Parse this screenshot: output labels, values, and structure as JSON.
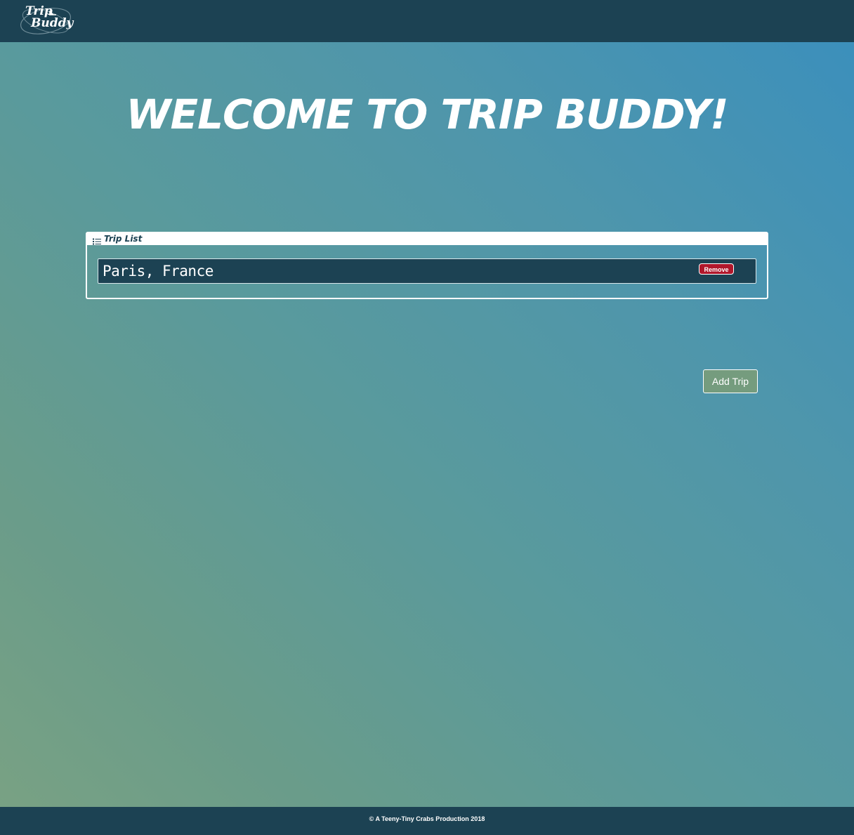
{
  "navbar": {
    "logo_text": "Trip Buddy",
    "logo_line1": "Trip",
    "logo_line2": "Buddy"
  },
  "main": {
    "heading": "WELCOME TO TRIP BUDDY!"
  },
  "trip_list": {
    "title": "Trip List",
    "icon": "list-icon",
    "items": [
      {
        "name": "Paris, France",
        "remove_label": "Remove"
      }
    ]
  },
  "actions": {
    "add_trip_label": "Add Trip"
  },
  "footer": {
    "text": "© A Teeny-Tiny Crabs Production 2018"
  },
  "colors": {
    "navbar": "#1c4253",
    "remove_button": "#b0172b",
    "add_button": "#759c7e",
    "gradient_top_right": "#3a8fbd",
    "gradient_bottom_left": "#7aa283"
  }
}
